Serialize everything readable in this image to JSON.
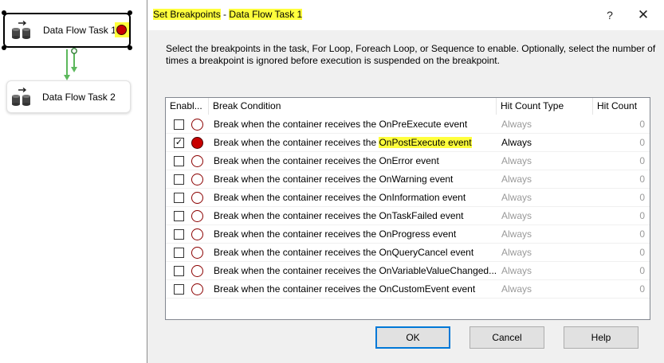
{
  "canvas": {
    "task1": {
      "label": "Data Flow Task 1",
      "icon": "data-flow-task-icon",
      "breakpoint_marker": "breakpoint-icon"
    },
    "task2": {
      "label": "Data Flow Task 2",
      "icon": "data-flow-task-icon"
    },
    "connector_color": "#5cb85c"
  },
  "dialog": {
    "title_part1": "Set Breakpoints",
    "title_sep": " - ",
    "title_part2": "Data Flow Task 1",
    "help_glyph": "?",
    "close_glyph": "✕",
    "instructions": "Select the breakpoints in the task, For Loop, Foreach Loop, or Sequence to enable. Optionally, select the number of times a breakpoint is ignored before execution is suspended on the breakpoint.",
    "grid": {
      "columns": [
        "Enabl...",
        "Break Condition",
        "Hit Count Type",
        "Hit Count"
      ],
      "rows": [
        {
          "enabled": false,
          "condition": "Break when the container receives the OnPreExecute event",
          "hit_count_type": "Always",
          "hit_count": "0"
        },
        {
          "enabled": true,
          "condition_prefix": "Break when the container receives the ",
          "condition_highlight": "OnPostExecute event",
          "hit_count_type": "Always",
          "hit_count": "0"
        },
        {
          "enabled": false,
          "condition": "Break when the container receives the OnError event",
          "hit_count_type": "Always",
          "hit_count": "0"
        },
        {
          "enabled": false,
          "condition": "Break when the container receives the OnWarning event",
          "hit_count_type": "Always",
          "hit_count": "0"
        },
        {
          "enabled": false,
          "condition": "Break when the container receives the OnInformation event",
          "hit_count_type": "Always",
          "hit_count": "0"
        },
        {
          "enabled": false,
          "condition": "Break when the container receives the OnTaskFailed event",
          "hit_count_type": "Always",
          "hit_count": "0"
        },
        {
          "enabled": false,
          "condition": "Break when the container receives the OnProgress event",
          "hit_count_type": "Always",
          "hit_count": "0"
        },
        {
          "enabled": false,
          "condition": "Break when the container receives the OnQueryCancel event",
          "hit_count_type": "Always",
          "hit_count": "0"
        },
        {
          "enabled": false,
          "condition": "Break when the container receives the OnVariableValueChanged...",
          "hit_count_type": "Always",
          "hit_count": "0"
        },
        {
          "enabled": false,
          "condition": "Break when the container receives the OnCustomEvent event",
          "hit_count_type": "Always",
          "hit_count": "0"
        }
      ]
    },
    "buttons": {
      "ok": "OK",
      "cancel": "Cancel",
      "help": "Help"
    },
    "colors": {
      "highlight": "#ffff3c",
      "breakpoint_red": "#c80000",
      "default_button_border": "#0078d7"
    }
  }
}
